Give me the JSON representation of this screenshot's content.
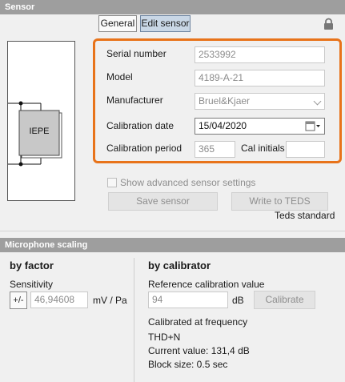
{
  "sensor_section": {
    "title": "Sensor",
    "tabs": [
      {
        "label": "General"
      },
      {
        "label": "Edit sensor"
      }
    ],
    "diagram_label": "IEPE",
    "fields": {
      "serial_number": {
        "label": "Serial number",
        "value": "2533992"
      },
      "model": {
        "label": "Model",
        "value": "4189-A-21"
      },
      "manufacturer": {
        "label": "Manufacturer",
        "value": "Bruel&Kjaer"
      },
      "calibration_date": {
        "label": "Calibration date",
        "value": "15/04/2020"
      },
      "calibration_period": {
        "label": "Calibration period",
        "value": "365"
      },
      "cal_initials": {
        "label": "Cal initials",
        "value": ""
      }
    },
    "show_advanced_label": "Show advanced sensor settings",
    "save_button": "Save sensor",
    "write_teds_button": "Write to TEDS",
    "teds_standard_label": "Teds standard",
    "accent_color": "#e8731a"
  },
  "microphone_section": {
    "title": "Microphone scaling",
    "by_factor": {
      "heading": "by factor",
      "sensitivity_label": "Sensitivity",
      "sign_button": "+/-",
      "sensitivity_value": "46,94608",
      "unit": "mV / Pa"
    },
    "by_calibrator": {
      "heading": "by calibrator",
      "ref_label": "Reference calibration value",
      "ref_value": "94",
      "ref_unit": "dB",
      "calibrate_button": "Calibrate",
      "calibrated_at": "Calibrated at frequency",
      "mode": "THD+N",
      "current_value": "Current value: 131,4 dB",
      "block_size": "Block size: 0.5 sec"
    }
  }
}
